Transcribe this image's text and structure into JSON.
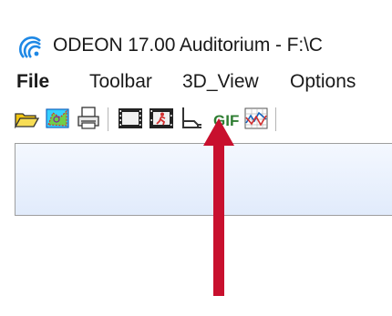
{
  "window": {
    "title": "ODEON 17.00 Auditorium  -  F:\\C",
    "app_icon": "odeon-logo-icon"
  },
  "menubar": {
    "items": [
      {
        "label": "File"
      },
      {
        "label": "Toolbar"
      },
      {
        "label": "3D_View"
      },
      {
        "label": "Options"
      }
    ]
  },
  "toolbar": {
    "buttons": [
      {
        "icon": "open-folder-icon"
      },
      {
        "icon": "room-model-icon"
      },
      {
        "icon": "print-icon"
      },
      {
        "icon": "film-icon"
      },
      {
        "icon": "animation-figure-icon"
      },
      {
        "icon": "chair-icon"
      },
      {
        "icon": "gif-icon"
      },
      {
        "icon": "graph-icon"
      }
    ]
  },
  "annotation": {
    "arrow_color": "#c8102e",
    "points_to": "animation-figure-icon"
  },
  "colors": {
    "accent_blue": "#1e88e5",
    "folder_yellow": "#f2c511",
    "gif_green": "#2e7d32"
  }
}
